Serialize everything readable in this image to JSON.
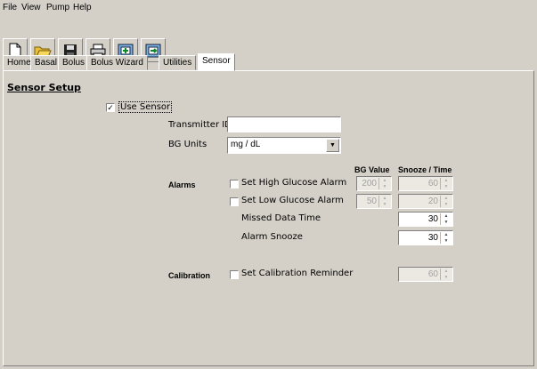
{
  "menu": [
    "File",
    "View",
    "Pump",
    "Help"
  ],
  "toolbar": [
    "new-document-icon",
    "open-folder-icon",
    "save-disk-icon",
    "print-icon",
    "import-icon",
    "export-icon"
  ],
  "tabs": [
    "Home",
    "Basal",
    "Bolus",
    "Bolus Wizard",
    "Utilities",
    "Sensor"
  ],
  "active_tab": "Sensor",
  "section_title": "Sensor Setup",
  "use_sensor": {
    "label": "Use Sensor",
    "checked": true
  },
  "transmitter": {
    "label": "Transmitter ID",
    "value": ""
  },
  "bg_units": {
    "label": "BG Units",
    "value": "mg / dL"
  },
  "alarms": {
    "group_label": "Alarms",
    "bg_value_header": "BG Value",
    "snooze_header": "Snooze / Time",
    "high": {
      "label": "Set High Glucose Alarm",
      "bg": "200",
      "snooze": "60"
    },
    "low": {
      "label": "Set Low Glucose Alarm",
      "bg": "50",
      "snooze": "20"
    },
    "missed": {
      "label": "Missed Data Time",
      "value": "30"
    },
    "snooze": {
      "label": "Alarm Snooze",
      "value": "30"
    }
  },
  "calibration": {
    "group_label": "Calibration",
    "label": "Set Calibration Reminder",
    "value": "60"
  }
}
